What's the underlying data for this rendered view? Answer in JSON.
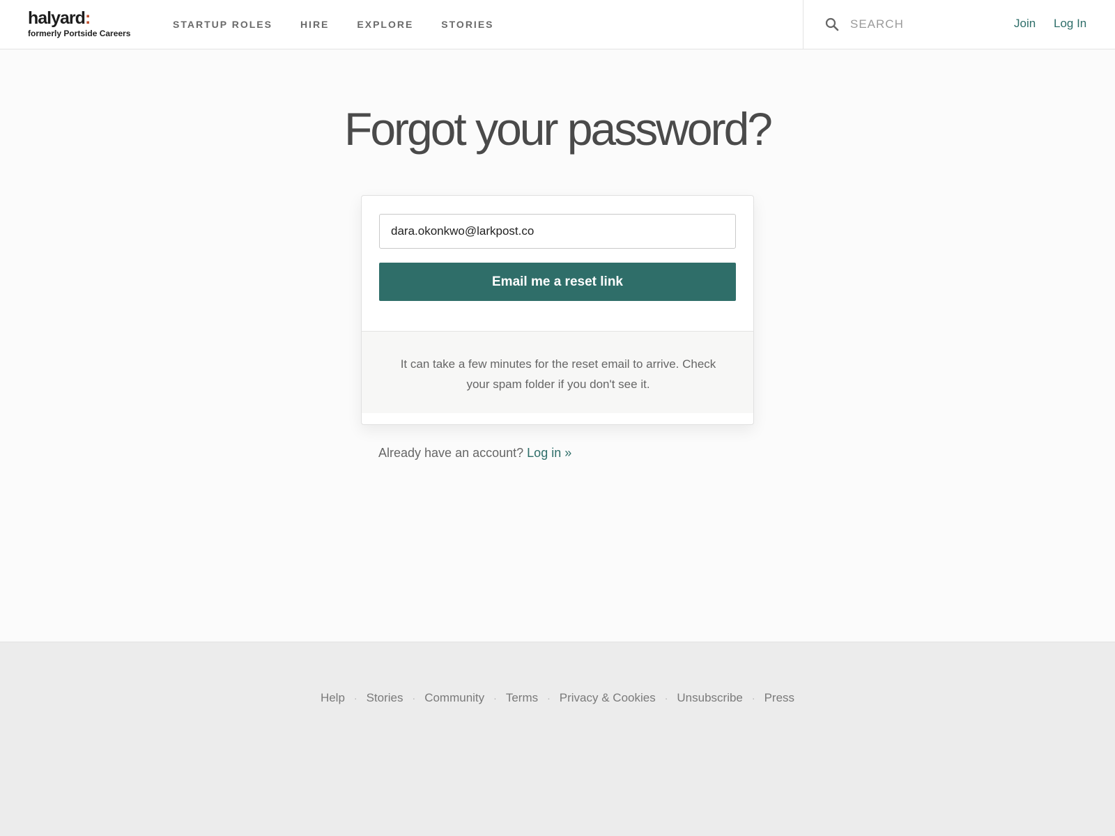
{
  "header": {
    "logo_main": "halyard",
    "logo_colon": ":",
    "logo_sub": "formerly Portside Careers",
    "nav": [
      "STARTUP ROLES",
      "HIRE",
      "EXPLORE",
      "STORIES"
    ],
    "search_placeholder": "SEARCH",
    "join_label": "Join",
    "login_label": "Log In",
    "search_icon": "search-icon"
  },
  "main": {
    "title": "Forgot your password?",
    "email_value": "dara.okonkwo@larkpost.co",
    "button_label": "Email me a reset link",
    "note": "It can take a few minutes for the reset email to arrive. Check your spam folder if you don't see it.",
    "already_text": "Already have an account?",
    "login_link": "Log in »"
  },
  "footer": {
    "links": [
      "Help",
      "Stories",
      "Community",
      "Terms",
      "Privacy & Cookies",
      "Unsubscribe",
      "Press"
    ],
    "separator": "·"
  },
  "colors": {
    "accent": "#2f6e69",
    "logo_colon": "#c0502d"
  }
}
